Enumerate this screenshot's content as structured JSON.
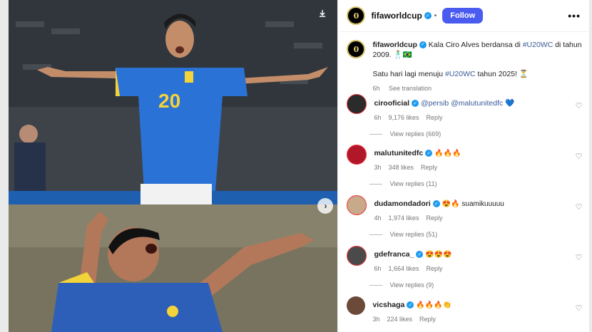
{
  "post": {
    "username": "fifaworldcup",
    "follow_label": "Follow",
    "more_label": "•••",
    "dot": "•",
    "caption": {
      "line1_prefix": "Kala Ciro Alves berdansa di ",
      "hashtag1": "#U20WC",
      "line1_suffix": " di tahun 2009. 🕺🇧🇷",
      "line2_prefix": "Satu hari lagi menuju ",
      "hashtag2": "#U20WC",
      "line2_suffix": " tahun 2025! ⏳",
      "time": "6h",
      "see_translation": "See translation"
    }
  },
  "media": {
    "top_jersey_number": "20",
    "save_icon": "download-icon",
    "next_icon": "chevron-right-icon"
  },
  "comments": [
    {
      "user": "cirooficial",
      "text": "@persib @malutunitedfc 💙",
      "time": "6h",
      "likes": "9,176 likes",
      "reply": "Reply",
      "replies": "View replies (669)",
      "avatar_color": "#2b2b2b"
    },
    {
      "user": "malutunitedfc",
      "text": "🔥🔥🔥",
      "time": "3h",
      "likes": "348 likes",
      "reply": "Reply",
      "replies": "View replies (11)",
      "avatar_color": "#b0182a"
    },
    {
      "user": "dudamondadori",
      "text": "😍🔥 suamikuuuuu",
      "time": "4h",
      "likes": "1,974 likes",
      "reply": "Reply",
      "replies": "View replies (51)",
      "avatar_color": "#c8a98a"
    },
    {
      "user": "gdefranca_",
      "text": "😍😍😍",
      "time": "6h",
      "likes": "1,664 likes",
      "reply": "Reply",
      "replies": "View replies (9)",
      "avatar_color": "#4a4a4a"
    },
    {
      "user": "vicshaga",
      "text": "🔥🔥🔥👏",
      "time": "3h",
      "likes": "224 likes",
      "reply": "Reply",
      "replies": "",
      "avatar_color": "#6b4a3a"
    }
  ],
  "colors": {
    "follow_button": "#4a5bf0",
    "verified_badge": "#1d9bf0",
    "hashtag": "#3b5998"
  }
}
